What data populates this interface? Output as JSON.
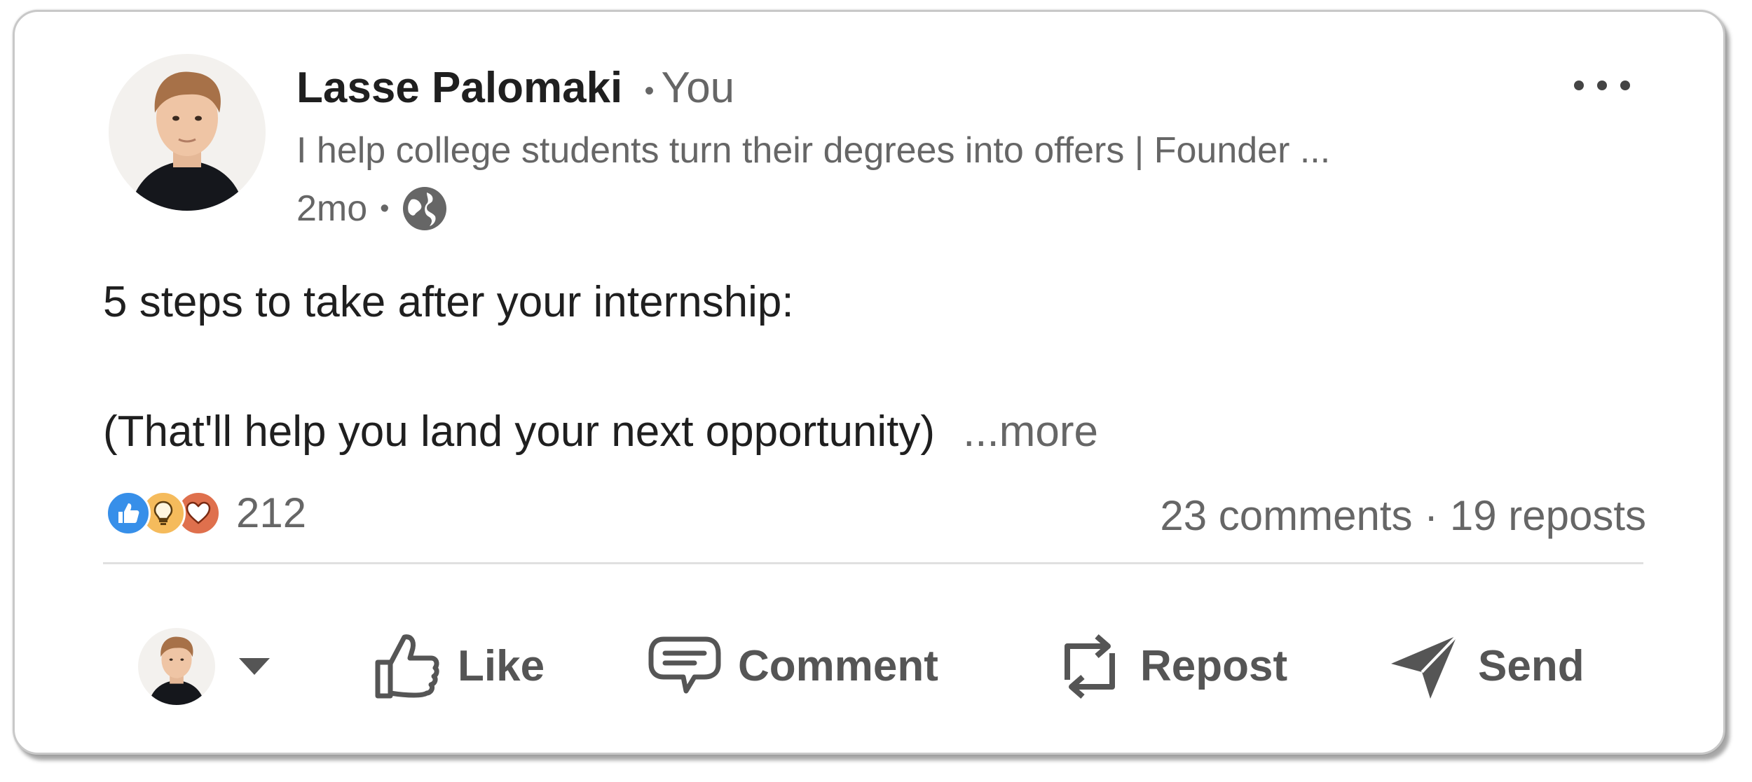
{
  "post": {
    "author": {
      "name": "Lasse Palomaki",
      "separator": "•",
      "relation": "You",
      "headline": "I help college students turn their degrees into offers | Founder ...",
      "time_ago": "2mo",
      "visibility_icon": "globe-icon"
    },
    "menu_icon": "more-horizontal-icon",
    "body": {
      "line1": "5 steps to take after your internship:",
      "line2": "(That'll help you land your next opportunity)",
      "see_more": "...more"
    },
    "reactions": {
      "icons": [
        "like-reaction-icon",
        "insightful-reaction-icon",
        "love-reaction-icon"
      ],
      "count": "212"
    },
    "social_counts": "23 comments · 19 reposts",
    "actions": {
      "like": "Like",
      "comment": "Comment",
      "repost": "Repost",
      "send": "Send"
    }
  },
  "colors": {
    "text_primary": "#1f1f1f",
    "text_secondary": "#666666",
    "action_text": "#555555",
    "like_blue": "#378fe9",
    "insightful_yellow": "#f5bb5c",
    "love_red": "#df704d"
  }
}
